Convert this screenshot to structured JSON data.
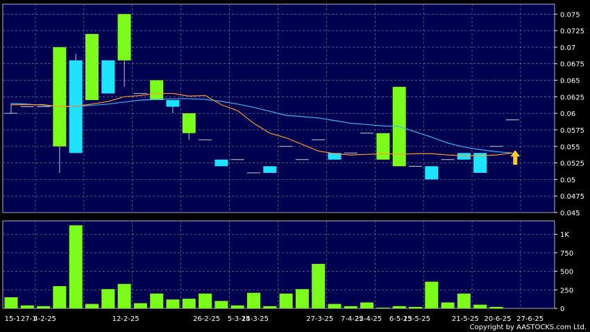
{
  "chart_data": {
    "type": "candlestick",
    "colors": {
      "background": "#000050",
      "grid": "#8a8aa8",
      "up": "#7cfc1a",
      "down": "#1ee3ff",
      "ma_short": "#ff9933",
      "ma_long": "#3ab4f2",
      "arrow": "#ffcc33",
      "text": "#ffffff"
    },
    "price_axis": {
      "min": 0.045,
      "max": 0.0765,
      "ticks": [
        "0.075",
        "0.0725",
        "0.07",
        "0.0675",
        "0.065",
        "0.0625",
        "0.06",
        "0.0575",
        "0.055",
        "0.0525",
        "0.05",
        "0.0475",
        "0.045"
      ]
    },
    "volume_axis": {
      "min": 0,
      "max": 1180,
      "ticks": [
        {
          "value": 1000,
          "label": "1K"
        },
        {
          "value": 750,
          "label": "750"
        },
        {
          "value": 500,
          "label": "500"
        },
        {
          "value": 250,
          "label": "250"
        },
        {
          "value": 0,
          "label": "0"
        }
      ]
    },
    "date_labels": [
      {
        "index": 0,
        "label": "15-1"
      },
      {
        "index": 1,
        "label": "27-1"
      },
      {
        "index": 2,
        "label": "4-2-25"
      },
      {
        "index": 7,
        "label": "12-2-25"
      },
      {
        "index": 12,
        "label": "26-2-25"
      },
      {
        "index": 14,
        "label": "5-3-25"
      },
      {
        "index": 15,
        "label": "14-3-25"
      },
      {
        "index": 19,
        "label": "27-3-25"
      },
      {
        "index": 21,
        "label": "7-4-25"
      },
      {
        "index": 22,
        "label": "22-4-25"
      },
      {
        "index": 24,
        "label": "6-5-25"
      },
      {
        "index": 25,
        "label": "13-5-25"
      },
      {
        "index": 28,
        "label": "21-5-25"
      },
      {
        "index": 30,
        "label": "20-6-25"
      },
      {
        "index": 32,
        "label": "27-6-25"
      }
    ],
    "candles": [
      {
        "o": 0.06,
        "h": 0.0615,
        "l": 0.06,
        "c": 0.06,
        "v": 150
      },
      {
        "o": 0.061,
        "h": 0.061,
        "l": 0.061,
        "c": 0.061,
        "v": 40
      },
      {
        "o": 0.061,
        "h": 0.061,
        "l": 0.061,
        "c": 0.061,
        "v": 30
      },
      {
        "o": 0.055,
        "h": 0.07,
        "l": 0.051,
        "c": 0.07,
        "v": 300
      },
      {
        "o": 0.068,
        "h": 0.069,
        "l": 0.054,
        "c": 0.054,
        "v": 1120
      },
      {
        "o": 0.062,
        "h": 0.072,
        "l": 0.062,
        "c": 0.072,
        "v": 60
      },
      {
        "o": 0.068,
        "h": 0.068,
        "l": 0.063,
        "c": 0.063,
        "v": 260
      },
      {
        "o": 0.068,
        "h": 0.075,
        "l": 0.064,
        "c": 0.075,
        "v": 330
      },
      {
        "o": 0.063,
        "h": 0.063,
        "l": 0.063,
        "c": 0.063,
        "v": 70
      },
      {
        "o": 0.062,
        "h": 0.065,
        "l": 0.062,
        "c": 0.065,
        "v": 200
      },
      {
        "o": 0.062,
        "h": 0.062,
        "l": 0.06,
        "c": 0.061,
        "v": 120
      },
      {
        "o": 0.057,
        "h": 0.06,
        "l": 0.056,
        "c": 0.06,
        "v": 130
      },
      {
        "o": 0.056,
        "h": 0.056,
        "l": 0.056,
        "c": 0.056,
        "v": 200
      },
      {
        "o": 0.053,
        "h": 0.053,
        "l": 0.052,
        "c": 0.052,
        "v": 100
      },
      {
        "o": 0.053,
        "h": 0.053,
        "l": 0.053,
        "c": 0.053,
        "v": 40
      },
      {
        "o": 0.051,
        "h": 0.051,
        "l": 0.051,
        "c": 0.051,
        "v": 210
      },
      {
        "o": 0.052,
        "h": 0.052,
        "l": 0.051,
        "c": 0.051,
        "v": 30
      },
      {
        "o": 0.055,
        "h": 0.055,
        "l": 0.055,
        "c": 0.055,
        "v": 200
      },
      {
        "o": 0.053,
        "h": 0.053,
        "l": 0.053,
        "c": 0.053,
        "v": 260
      },
      {
        "o": 0.056,
        "h": 0.056,
        "l": 0.056,
        "c": 0.056,
        "v": 600
      },
      {
        "o": 0.054,
        "h": 0.054,
        "l": 0.053,
        "c": 0.053,
        "v": 60
      },
      {
        "o": 0.054,
        "h": 0.054,
        "l": 0.054,
        "c": 0.054,
        "v": 30
      },
      {
        "o": 0.057,
        "h": 0.057,
        "l": 0.057,
        "c": 0.057,
        "v": 80
      },
      {
        "o": 0.053,
        "h": 0.057,
        "l": 0.053,
        "c": 0.057,
        "v": 10
      },
      {
        "o": 0.052,
        "h": 0.064,
        "l": 0.052,
        "c": 0.064,
        "v": 30
      },
      {
        "o": 0.052,
        "h": 0.052,
        "l": 0.052,
        "c": 0.052,
        "v": 20
      },
      {
        "o": 0.052,
        "h": 0.052,
        "l": 0.05,
        "c": 0.05,
        "v": 360
      },
      {
        "o": 0.053,
        "h": 0.053,
        "l": 0.053,
        "c": 0.053,
        "v": 80
      },
      {
        "o": 0.054,
        "h": 0.054,
        "l": 0.053,
        "c": 0.053,
        "v": 200
      },
      {
        "o": 0.054,
        "h": 0.054,
        "l": 0.051,
        "c": 0.051,
        "v": 50
      },
      {
        "o": 0.055,
        "h": 0.055,
        "l": 0.055,
        "c": 0.055,
        "v": 20
      },
      {
        "o": 0.059,
        "h": 0.059,
        "l": 0.059,
        "c": 0.059,
        "v": 0
      }
    ],
    "ma_short": [
      0.0613,
      0.0613,
      0.0613,
      0.061,
      0.0611,
      0.0614,
      0.0618,
      0.0625,
      0.0627,
      0.063,
      0.063,
      0.0626,
      0.0627,
      0.0613,
      0.0604,
      0.0585,
      0.057,
      0.0563,
      0.0553,
      0.0543,
      0.0539,
      0.0537,
      0.0538,
      0.0539,
      0.0538,
      0.0539,
      0.0539,
      0.0537,
      0.0536,
      0.0536,
      0.0537,
      0.054
    ],
    "ma_long": [
      0.0615,
      0.0614,
      0.0612,
      0.061,
      0.061,
      0.0612,
      0.0614,
      0.0617,
      0.062,
      0.0621,
      0.0622,
      0.0622,
      0.0621,
      0.0618,
      0.0614,
      0.0609,
      0.0603,
      0.0597,
      0.0595,
      0.0593,
      0.0589,
      0.0585,
      0.0583,
      0.0581,
      0.058,
      0.0572,
      0.0564,
      0.0555,
      0.0549,
      0.0545,
      0.0542,
      0.054
    ]
  },
  "copyright": "Copyright by AASTOCKS.com Ltd."
}
